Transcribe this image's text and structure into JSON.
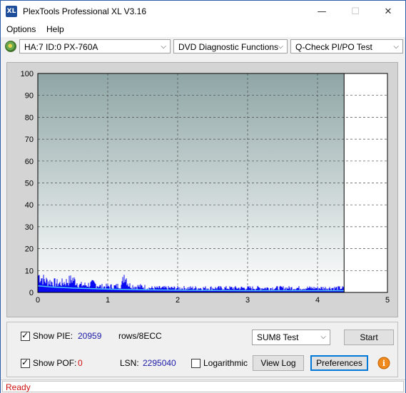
{
  "window": {
    "title": "PlexTools Professional XL V3.16",
    "icon_text": "XL",
    "minimize": "—",
    "maximize": "☐",
    "close": "✕"
  },
  "menu": {
    "options": "Options",
    "help": "Help"
  },
  "toolbar": {
    "drive": "HA:7 ID:0  PX-760A",
    "function": "DVD Diagnostic Functions",
    "test": "Q-Check PI/PO Test",
    "dropdown_arrow": "⌵"
  },
  "chart_data": {
    "type": "bar",
    "title": "",
    "xlabel": "",
    "ylabel": "",
    "xlim": [
      0,
      5
    ],
    "ylim": [
      0,
      100
    ],
    "x_ticks": [
      "0",
      "1",
      "2",
      "3",
      "4",
      "5"
    ],
    "y_ticks": [
      "0",
      "10",
      "20",
      "30",
      "40",
      "50",
      "60",
      "70",
      "80",
      "90",
      "100"
    ],
    "grid": true,
    "data_end_x": 4.38,
    "series": [
      {
        "values_note": "PIE per 8ECC",
        "color": "#0a0af0",
        "x": [
          0.0,
          0.1,
          0.2,
          0.3,
          0.4,
          0.5,
          0.6,
          0.7,
          0.8,
          0.9,
          1.0,
          1.1,
          1.2,
          1.24,
          1.3,
          1.4,
          1.5,
          1.6,
          1.7,
          1.8,
          1.9,
          2.0,
          2.2,
          2.4,
          2.6,
          2.8,
          3.0,
          3.2,
          3.4,
          3.6,
          3.8,
          4.0,
          4.2,
          4.38
        ],
        "y": [
          12,
          8,
          7,
          6,
          7,
          9,
          5,
          5,
          6,
          4,
          4,
          4,
          5,
          13,
          5,
          4,
          4,
          3,
          3,
          3,
          3,
          3,
          3,
          3,
          3,
          3,
          3,
          3,
          3,
          3,
          3,
          3,
          3,
          3
        ]
      },
      {
        "values_note": "average line",
        "color": "#4fc3f7",
        "x": [
          0.0,
          0.2,
          0.5,
          1.0,
          1.5,
          2.0,
          3.0,
          4.0,
          4.38
        ],
        "y": [
          3,
          2.5,
          2,
          1.5,
          1.2,
          1,
          0.8,
          0.8,
          0.8
        ]
      }
    ],
    "colors": {
      "plot_bg_top": "#8fa6a6",
      "plot_bg_bottom": "#ffffff",
      "panel_bg": "#d4d4d4",
      "grid": "#4a4a4a"
    }
  },
  "controls": {
    "show_pie_label": "Show PIE:",
    "pie_value": "20959",
    "pie_unit": "rows/8ECC",
    "show_pof_label": "Show POF:",
    "pof_value": "0",
    "lsn_label": "LSN:",
    "lsn_value": "2295040",
    "logarithmic_label": "Logarithmic",
    "test_select": "SUM8 Test",
    "start_button": "Start",
    "view_log_button": "View Log",
    "preferences_button": "Preferences",
    "info_icon": "i"
  },
  "status": {
    "text": "Ready"
  }
}
